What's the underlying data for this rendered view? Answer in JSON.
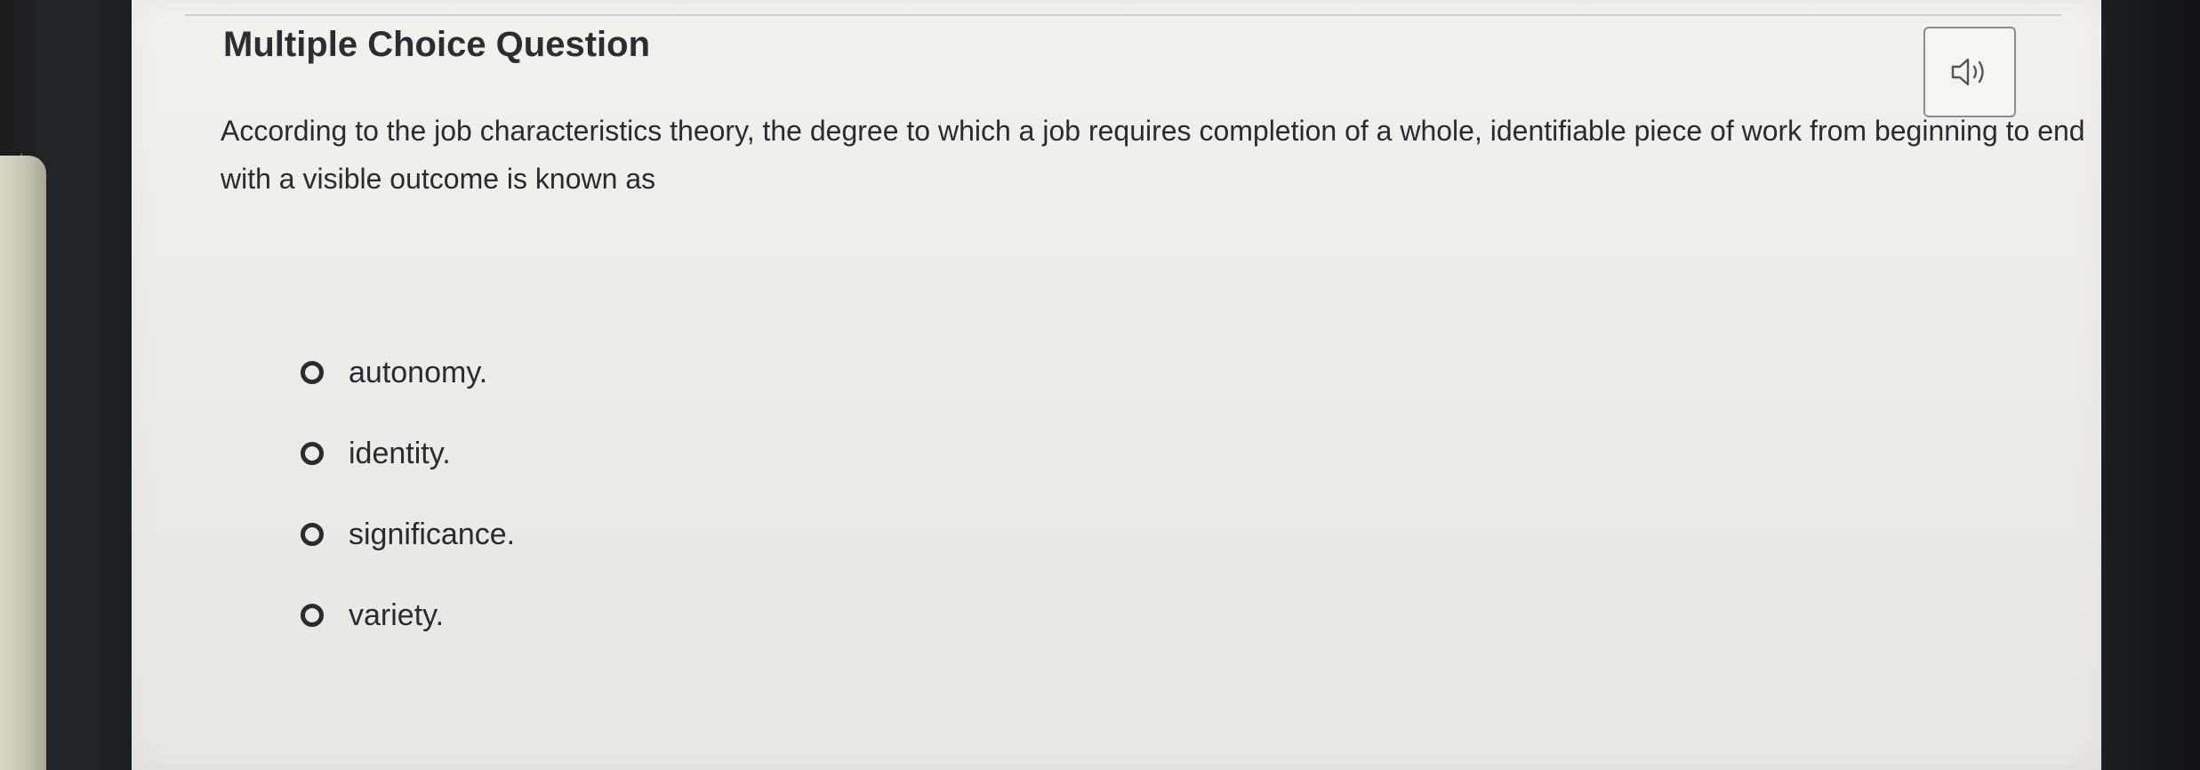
{
  "question": {
    "heading": "Multiple Choice Question",
    "text": "According to the job characteristics theory, the degree to which a job requires completion of a whole, identifiable piece of work from beginning to end with a visible outcome is known as",
    "options": [
      {
        "label": "autonomy."
      },
      {
        "label": "identity."
      },
      {
        "label": "significance."
      },
      {
        "label": "variety."
      }
    ]
  },
  "controls": {
    "audio_icon": "speaker-icon"
  }
}
